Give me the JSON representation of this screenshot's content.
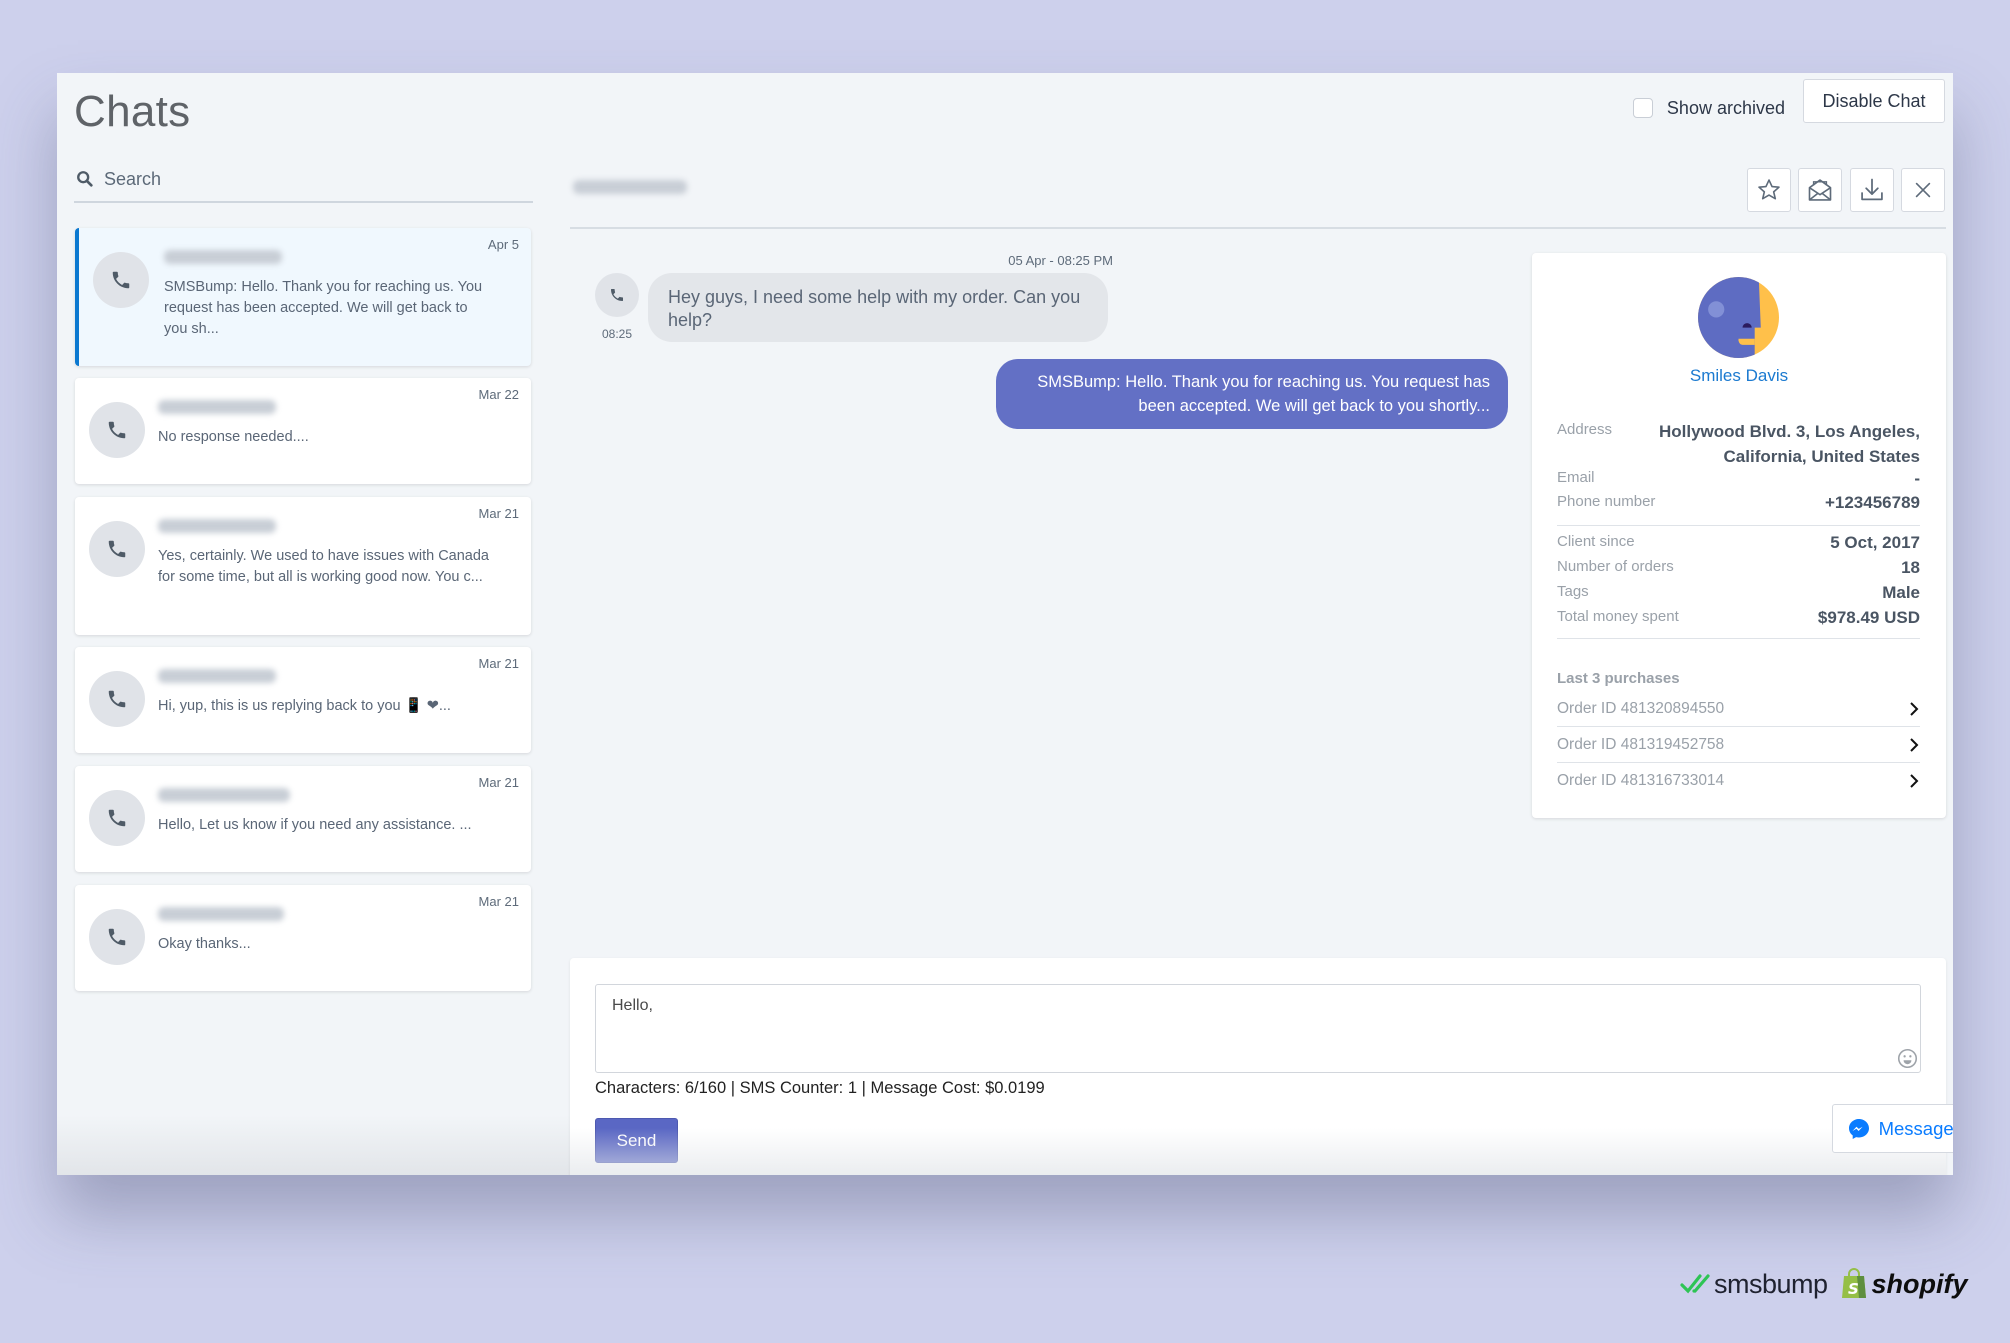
{
  "header": {
    "title": "Chats",
    "show_archived_label": "Show archived",
    "show_archived_checked": false,
    "disable_chat_label": "Disable Chat"
  },
  "search": {
    "placeholder": "Search",
    "value": ""
  },
  "chat_list": [
    {
      "date": "Apr 5",
      "preview": "SMSBump: Hello. Thank you for reaching us. You request has been accepted. We will get back to you sh...",
      "active": true
    },
    {
      "date": "Mar 22",
      "preview": "No response needed....",
      "active": false
    },
    {
      "date": "Mar 21",
      "preview": "Yes, certainly. We used to have issues with Canada for some time, but all is working good now. You c...",
      "active": false
    },
    {
      "date": "Mar 21",
      "preview": "Hi, yup, this is us replying back to you 📱 ❤...",
      "active": false
    },
    {
      "date": "Mar 21",
      "preview": "Hello, Let us know if you need any assistance. ...",
      "active": false
    },
    {
      "date": "Mar 21",
      "preview": "Okay thanks...",
      "active": false
    }
  ],
  "conversation": {
    "actions": [
      "star-icon",
      "mail-open-icon",
      "download-icon",
      "close-icon"
    ],
    "messages": [
      {
        "direction": "incoming",
        "timestamp": "05 Apr - 08:25 PM",
        "time": "08:25",
        "text": "Hey guys, I need some help with my order. Can you help?"
      },
      {
        "direction": "outgoing",
        "text": "SMSBump: Hello. Thank you for reaching us. You request has been accepted. We will get back to you shortly..."
      }
    ]
  },
  "customer": {
    "name": "Smiles Davis",
    "fields": [
      {
        "label": "Address",
        "value": "Hollywood Blvd. 3, Los Angeles, California, United States"
      },
      {
        "label": "Email",
        "value": "-"
      },
      {
        "label": "Phone number",
        "value": "+123456789"
      },
      {
        "label": "Client since",
        "value": "5 Oct, 2017"
      },
      {
        "label": "Number of orders",
        "value": "18"
      },
      {
        "label": "Tags",
        "value": "Male"
      },
      {
        "label": "Total money spent",
        "value": "$978.49 USD"
      }
    ],
    "purchases_title": "Last 3 purchases",
    "purchases": [
      {
        "label": "Order ID 481320894550"
      },
      {
        "label": "Order ID 481319452758"
      },
      {
        "label": "Order ID 481316733014"
      }
    ]
  },
  "compose": {
    "value": "Hello,",
    "counter": "Characters: 6/160 | SMS Counter: 1 | Message Cost: $0.0199",
    "send_label": "Send",
    "messenger_label": "Message Us"
  },
  "brands": {
    "smsbump": "smsbump",
    "shopify": "shopify"
  },
  "colors": {
    "accent": "#5a67c4",
    "outgoing_bubble": "#6370c5",
    "link": "#1b7ad0",
    "messenger": "#0a7cff",
    "active_border": "#0b78d0"
  }
}
